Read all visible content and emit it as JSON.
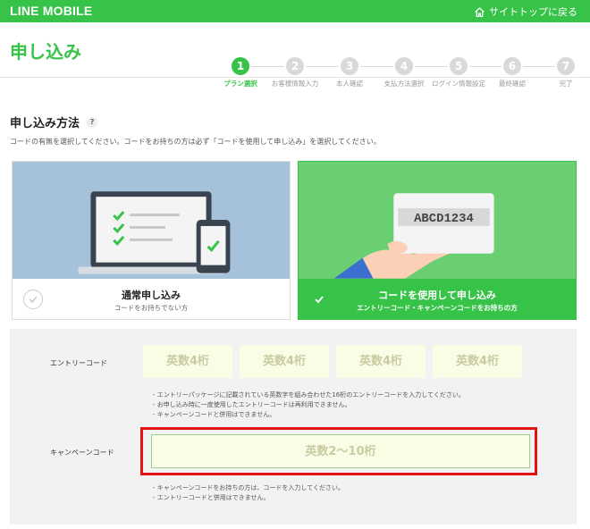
{
  "brand": {
    "logo_text": "LINE MOBILE",
    "accent": "#37c248"
  },
  "topbar": {
    "home_link": "サイトトップに戻る",
    "home_icon": "home-icon"
  },
  "page_title": "申し込み",
  "steps": [
    {
      "number": "1",
      "label": "プラン選択",
      "active": true
    },
    {
      "number": "2",
      "label": "お客様情報入力",
      "active": false
    },
    {
      "number": "3",
      "label": "本人確認",
      "active": false
    },
    {
      "number": "4",
      "label": "支払方法選択",
      "active": false
    },
    {
      "number": "5",
      "label": "ログイン情報設定",
      "active": false
    },
    {
      "number": "6",
      "label": "最終確認",
      "active": false
    },
    {
      "number": "7",
      "label": "完了",
      "active": false
    }
  ],
  "section": {
    "title": "申し込み方法",
    "help": "?",
    "description": "コードの有無を選択してください。コードをお持ちの方は必ず「コードを使用して申し込み」を選択してください。"
  },
  "options": {
    "normal": {
      "title": "通常申し込み",
      "subtitle": "コードをお持ちでない方",
      "selected": false
    },
    "code": {
      "title": "コードを使用して申し込み",
      "subtitle": "エントリーコード・キャンペーンコードをお持ちの方",
      "selected": true,
      "card_text": "ABCD1234"
    }
  },
  "entry_code": {
    "label": "エントリーコード",
    "placeholders": [
      "英数4桁",
      "英数4桁",
      "英数4桁",
      "英数4桁"
    ],
    "notes": [
      "- エントリーパッケージに記載されている英数字を組み合わせた16桁のエントリーコードを入力してください。",
      "- お申し込み時に一度使用したエントリーコードは再利用できません。",
      "- キャンペーンコードと併用はできません。"
    ]
  },
  "campaign_code": {
    "label": "キャンペーンコード",
    "placeholder": "英数2〜10桁",
    "notes": [
      "- キャンペーンコードをお持ちの方は、コードを入力してください。",
      "- エントリーコードと併用はできません。"
    ]
  }
}
